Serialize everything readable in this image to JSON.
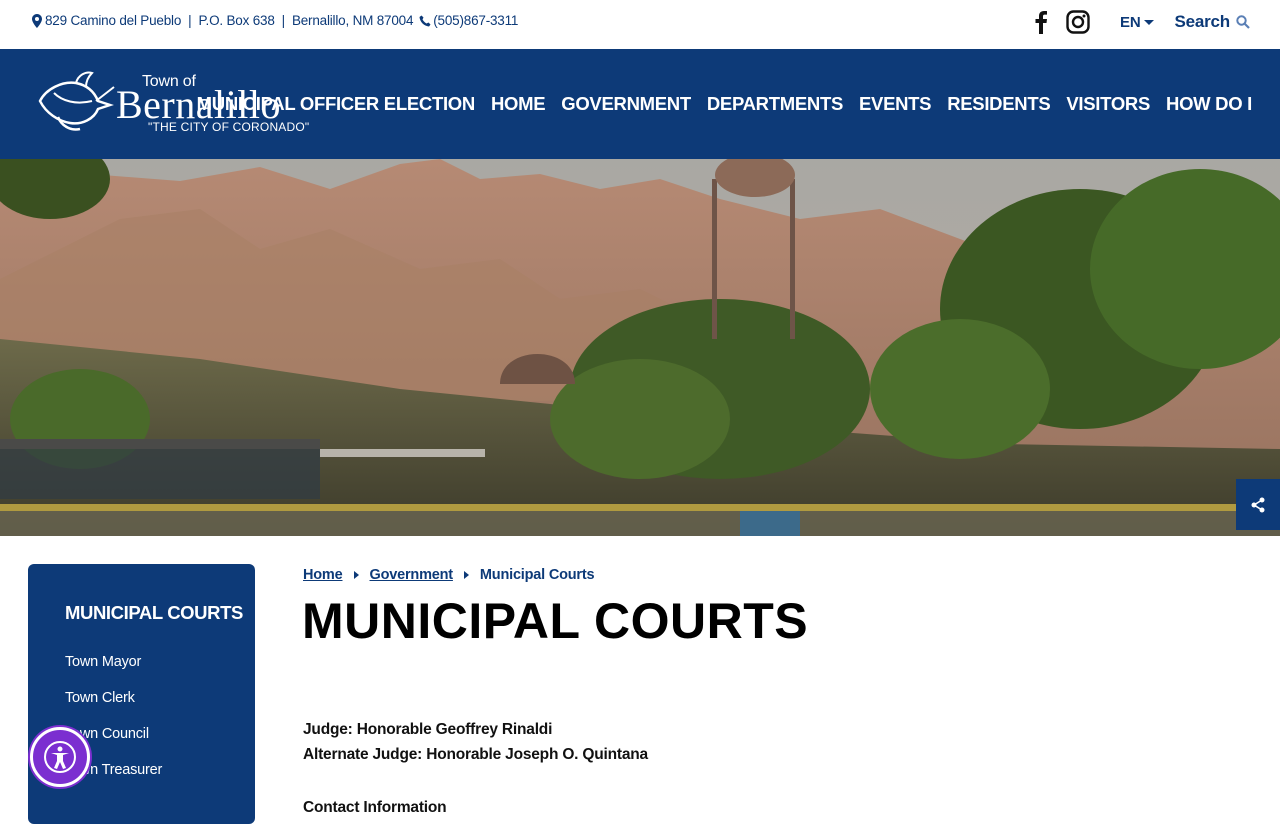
{
  "topbar": {
    "address": "829 Camino del Pueblo",
    "po_box": "P.O. Box 638",
    "city": "Bernalillo, NM  87004",
    "phone": "(505)867-3311",
    "language": "EN",
    "search_label": "Search"
  },
  "logo": {
    "town_of": "Town of",
    "name": "Bernalillo",
    "tagline": "\"THE CITY OF CORONADO\""
  },
  "nav": [
    "MUNICIPAL OFFICER ELECTION",
    "HOME",
    "GOVERNMENT",
    "DEPARTMENTS",
    "EVENTS",
    "RESIDENTS",
    "VISITORS",
    "HOW DO I"
  ],
  "sidebar": {
    "title": "MUNICIPAL COURTS",
    "items": [
      "Town Mayor",
      "Town Clerk",
      "Town Council",
      "Town Treasurer"
    ]
  },
  "breadcrumb": [
    "Home",
    "Government",
    "Municipal Courts"
  ],
  "page_title": "MUNICIPAL COURTS",
  "content": {
    "judge": "Judge: Honorable Geoffrey Rinaldi",
    "alternate_judge": "Alternate Judge: Honorable Joseph O. Quintana",
    "contact_heading": "Contact Information"
  },
  "colors": {
    "brand_navy": "#0d3a78",
    "accessibility_purple": "#7b2fd0"
  }
}
